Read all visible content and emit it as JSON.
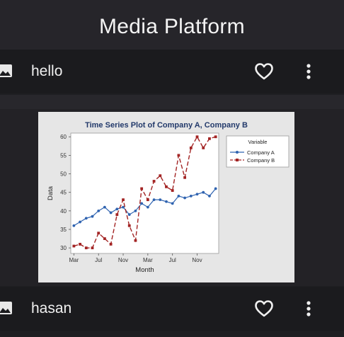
{
  "app_bar": {
    "title": "Media Platform"
  },
  "posts": [
    {
      "name": "hello",
      "media_icon": "image-icon",
      "like_icon": "heart-outline-icon",
      "menu_icon": "more-vert-icon"
    },
    {
      "name": "hasan",
      "media_icon": "image-icon",
      "like_icon": "heart-outline-icon",
      "menu_icon": "more-vert-icon"
    }
  ],
  "chart_data": {
    "type": "line",
    "title": "Time Series Plot of Company A, Company B",
    "xlabel": "Month",
    "ylabel": "Data",
    "x": [
      1,
      2,
      3,
      4,
      5,
      6,
      7,
      8,
      9,
      10,
      11,
      12,
      13,
      14,
      15,
      16,
      17,
      18,
      19,
      20,
      21,
      22,
      23,
      24
    ],
    "x_tick_labels": [
      "Mar",
      "Jul",
      "Nov",
      "Mar",
      "Jul",
      "Nov"
    ],
    "x_tick_positions": [
      1,
      5,
      9,
      13,
      17,
      21
    ],
    "yticks": [
      30,
      35,
      40,
      45,
      50,
      55,
      60
    ],
    "ylim": [
      28.5,
      61
    ],
    "legend_title": "Variable",
    "legend_position": "right",
    "series": [
      {
        "name": "Company A",
        "color": "#2f63b0",
        "style": "solid",
        "values": [
          36,
          37,
          38,
          38.5,
          40,
          41,
          39.5,
          40.5,
          41,
          39,
          40,
          42,
          41,
          43,
          43,
          42.5,
          42,
          44,
          43.5,
          44,
          44.5,
          45,
          44,
          46
        ]
      },
      {
        "name": "Company B",
        "color": "#a32424",
        "style": "dashed",
        "values": [
          30.5,
          31,
          30,
          30,
          34,
          32.5,
          31,
          39,
          43,
          36,
          32,
          46,
          43,
          48,
          49.5,
          46.5,
          45.5,
          55,
          49,
          57,
          60,
          57,
          59.5,
          60
        ]
      }
    ],
    "grid": false
  }
}
